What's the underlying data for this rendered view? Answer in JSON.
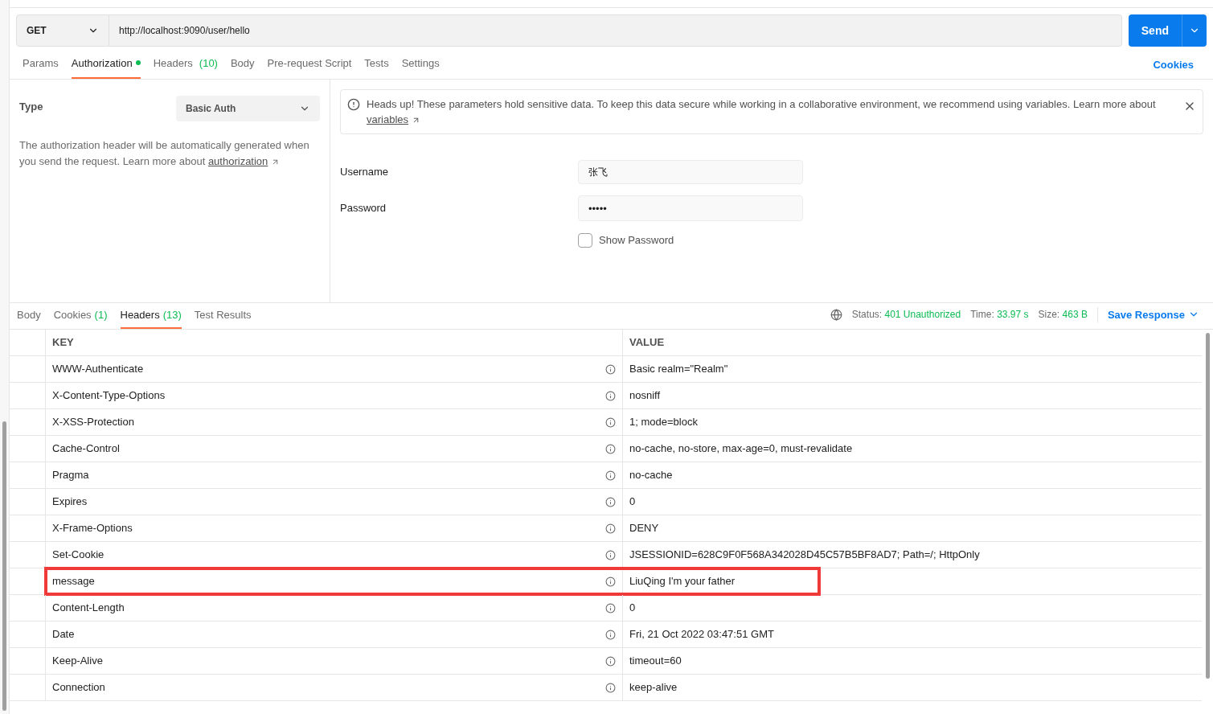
{
  "request": {
    "method": "GET",
    "url": "http://localhost:9090/user/hello",
    "send": "Send"
  },
  "request_tabs": [
    {
      "label": "Params",
      "dot": false,
      "selected": false
    },
    {
      "label": "Authorization",
      "dot": true,
      "selected": true
    },
    {
      "label": "Headers",
      "count": "(10)",
      "dot": false,
      "selected": false
    },
    {
      "label": "Body",
      "dot": false,
      "selected": false
    },
    {
      "label": "Pre-request Script",
      "dot": false,
      "selected": false
    },
    {
      "label": "Tests",
      "dot": false,
      "selected": false
    },
    {
      "label": "Settings",
      "dot": false,
      "selected": false
    }
  ],
  "cookies_link": "Cookies",
  "auth": {
    "type_label": "Type",
    "type_value": "Basic Auth",
    "description": "The authorization header will be automatically generated when you send the request. Learn more about",
    "description_link": "authorization",
    "notice": "Heads up! These parameters hold sensitive data. To keep this data secure while working in a collaborative environment, we recommend using variables. Learn more about",
    "notice_link": "variables",
    "username_label": "Username",
    "username": "张飞",
    "password_label": "Password",
    "password": "•••••",
    "show_password": {
      "label": "Show Password",
      "checked": false
    }
  },
  "response_tabs": [
    {
      "label": "Body",
      "selected": false
    },
    {
      "label": "Cookies",
      "count": "(1)",
      "selected": false
    },
    {
      "label": "Headers",
      "count": "(13)",
      "selected": true
    },
    {
      "label": "Test Results",
      "selected": false
    }
  ],
  "status": {
    "status_label": "Status:",
    "status": "401 Unauthorized",
    "time_label": "Time:",
    "time": "33.97 s",
    "size_label": "Size:",
    "size": "463 B",
    "save": "Save Response"
  },
  "table": {
    "columns": [
      "KEY",
      "VALUE"
    ],
    "rows": [
      {
        "key": "WWW-Authenticate",
        "value": "Basic realm=\"Realm\"",
        "highlighted": false
      },
      {
        "key": "X-Content-Type-Options",
        "value": "nosniff",
        "highlighted": false
      },
      {
        "key": "X-XSS-Protection",
        "value": "1; mode=block",
        "highlighted": false
      },
      {
        "key": "Cache-Control",
        "value": "no-cache, no-store, max-age=0, must-revalidate",
        "highlighted": false
      },
      {
        "key": "Pragma",
        "value": "no-cache",
        "highlighted": false
      },
      {
        "key": "Expires",
        "value": "0",
        "highlighted": false
      },
      {
        "key": "X-Frame-Options",
        "value": "DENY",
        "highlighted": false
      },
      {
        "key": "Set-Cookie",
        "value": "JSESSIONID=628C9F0F568A342028D45C57B5BF8AD7; Path=/; HttpOnly",
        "highlighted": false
      },
      {
        "key": "message",
        "value": "LiuQing I'm your father",
        "highlighted": true
      },
      {
        "key": "Content-Length",
        "value": "0",
        "highlighted": false
      },
      {
        "key": "Date",
        "value": "Fri, 21 Oct 2022 03:47:51 GMT",
        "highlighted": false
      },
      {
        "key": "Keep-Alive",
        "value": "timeout=60",
        "highlighted": false
      },
      {
        "key": "Connection",
        "value": "keep-alive",
        "highlighted": false
      }
    ]
  }
}
